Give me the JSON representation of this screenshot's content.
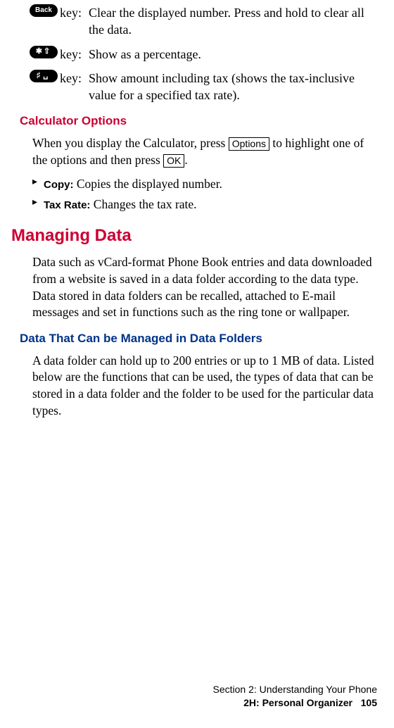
{
  "keys": {
    "back": {
      "badge": "Back",
      "label": "key:",
      "desc": "Clear the displayed number. Press and hold to clear all the data."
    },
    "star": {
      "badge": "✱⇧",
      "label": "key:",
      "desc": "Show as a percentage."
    },
    "hash": {
      "badge": "♯␣",
      "label": "key:",
      "desc": "Show amount including tax (shows the tax-inclusive value for a specified tax rate)."
    }
  },
  "calcOptions": {
    "heading": "Calculator Options",
    "para_pre": "When you display the Calculator, press ",
    "softkey1": "Options",
    "para_mid": " to highlight one of the options and then press ",
    "softkey2": "OK",
    "para_post": ".",
    "bullets": {
      "copy": {
        "label": "Copy:",
        "desc": " Copies the displayed number."
      },
      "tax": {
        "label": "Tax Rate:",
        "desc": " Changes the tax rate."
      }
    }
  },
  "managing": {
    "heading": "Managing Data",
    "para": "Data such as vCard-format Phone Book entries and data downloaded from a website is saved in a data folder according to the data type. Data stored in data folders can be recalled, attached to E-mail messages and set in functions such as the ring tone or wallpaper."
  },
  "dataFolders": {
    "heading": "Data That Can be Managed in Data Folders",
    "para": "A data folder can hold up to 200 entries or up to 1 MB of data. Listed below are the functions that can be used, the types of data that can be stored in a data folder and the folder to be used for the particular data types."
  },
  "footer": {
    "line1": "Section 2: Understanding Your Phone",
    "line2a": "2H: Personal Organizer",
    "pnum": "105"
  }
}
